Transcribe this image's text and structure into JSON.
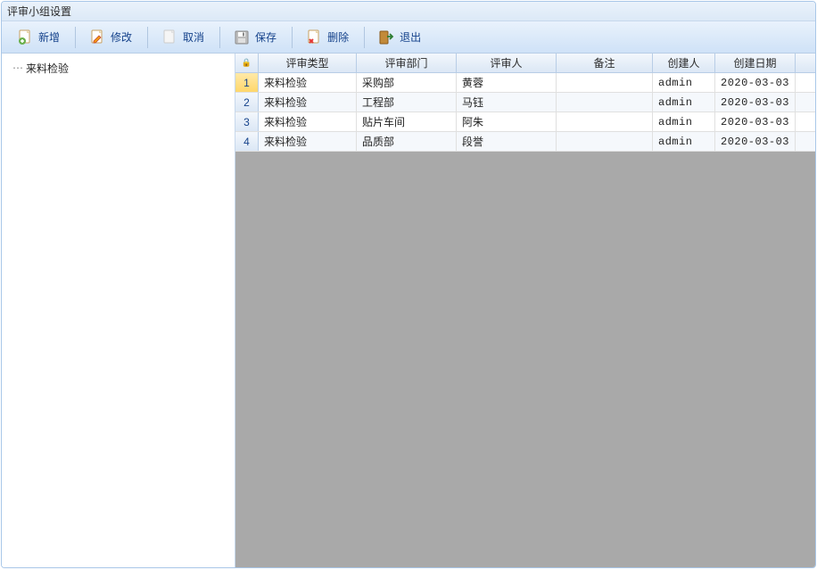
{
  "window": {
    "title": "评审小组设置"
  },
  "toolbar": {
    "add": "新增",
    "edit": "修改",
    "cancel": "取消",
    "save": "保存",
    "delete": "删除",
    "exit": "退出"
  },
  "tree": {
    "items": [
      {
        "label": "来料检验"
      }
    ]
  },
  "grid": {
    "headers": {
      "rownum": "",
      "type": "评审类型",
      "dept": "评审部门",
      "person": "评审人",
      "remark": "备注",
      "creator": "创建人",
      "date": "创建日期"
    },
    "rows": [
      {
        "type": "来料检验",
        "dept": "采购部",
        "person": "黄蓉",
        "remark": "",
        "creator": "admin",
        "date": "2020-03-03"
      },
      {
        "type": "来料检验",
        "dept": "工程部",
        "person": "马钰",
        "remark": "",
        "creator": "admin",
        "date": "2020-03-03"
      },
      {
        "type": "来料检验",
        "dept": "贴片车间",
        "person": "阿朱",
        "remark": "",
        "creator": "admin",
        "date": "2020-03-03"
      },
      {
        "type": "来料检验",
        "dept": "品质部",
        "person": "段誉",
        "remark": "",
        "creator": "admin",
        "date": "2020-03-03"
      }
    ],
    "selectedIndex": 0
  }
}
